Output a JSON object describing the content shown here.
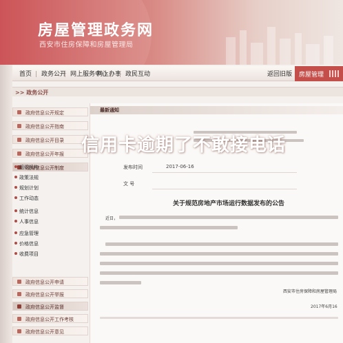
{
  "header": {
    "title": "房屋管理政务网",
    "subtitle": "西安市住房保障和房屋管理局"
  },
  "nav": {
    "items": [
      "首页",
      "政务公开",
      "网上服务中心",
      "网上办事",
      "政民互动"
    ],
    "right": "返回旧版",
    "tag": "房屋管理"
  },
  "breadcrumb": "政务公开",
  "sidebar": {
    "items": [
      "政府信息公开规定",
      "政府信息公开指南",
      "政府信息公开目录",
      "政府信息公开年报",
      "政府信息公开制度"
    ],
    "sub_items": [
      "组织机构",
      "政策法规",
      "规划计划",
      "工作动态",
      "统计信息",
      "人事信息",
      "应急管理",
      "价格信息",
      "收费项目"
    ],
    "bottom_items": [
      "政府信息公开申请",
      "政府信息公开举报",
      "政府信息公开监督",
      "政府信息公开工作考核",
      "政府信息公开意见"
    ]
  },
  "panel": {
    "head": "最新通知",
    "meta_labels": [
      "发布时间",
      "文    号"
    ],
    "date": "2017-06-16",
    "article_title": "关于规范房地产市场运行数据发布的公告",
    "salutation": "近日，",
    "signature": "西安市住房保障和房屋管理局",
    "sign_date": "2017年6月16"
  },
  "overlay_text": "信用卡逾期了不敢接电话"
}
